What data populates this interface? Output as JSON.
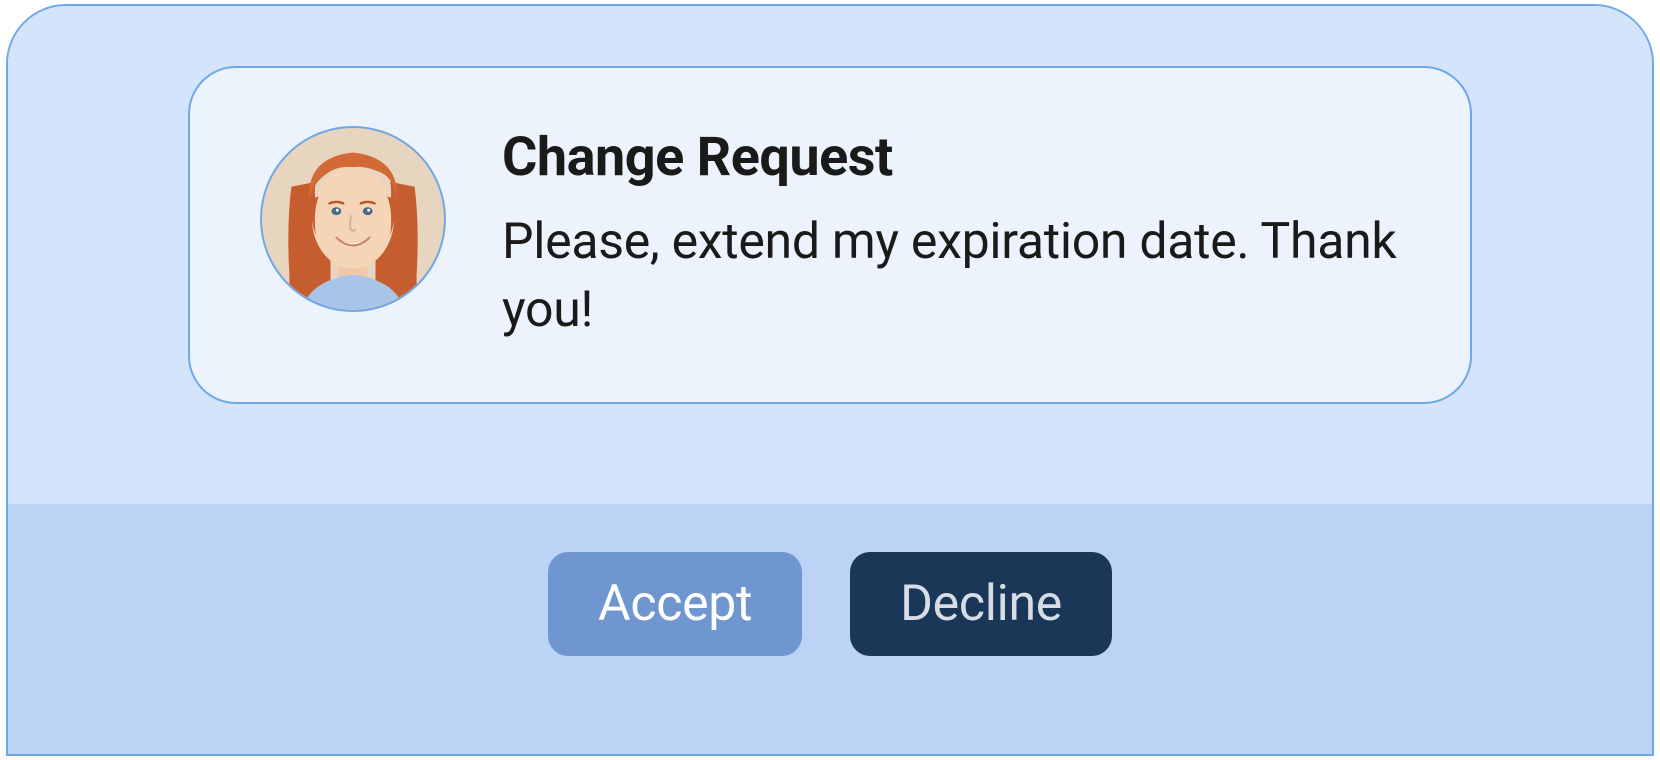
{
  "card": {
    "title": "Change Request",
    "body": "Please, extend my expiration date. Thank you!",
    "avatar_alt": "user-avatar"
  },
  "actions": {
    "accept_label": "Accept",
    "decline_label": "Decline"
  }
}
